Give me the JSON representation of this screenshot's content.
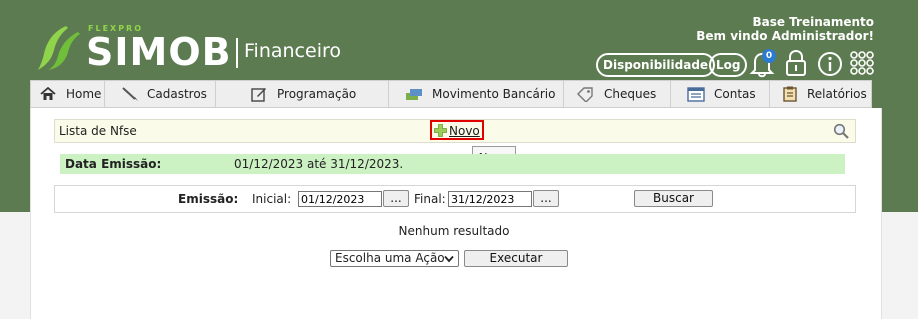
{
  "brand": {
    "small": "FLEXPRO",
    "name": "SIMOB",
    "module": "Financeiro",
    "logo_color": "#8fd44a"
  },
  "header": {
    "company": "Base Treinamento",
    "welcome": "Bem vindo Administrador!",
    "availability_label": "Disponibilidade",
    "log_label": "Log",
    "notification_count": "0",
    "bg_color": "#5d7b51"
  },
  "nav": {
    "items": [
      {
        "label": "Home",
        "icon": "home-icon"
      },
      {
        "label": "Cadastros",
        "icon": "pen-icon"
      },
      {
        "label": "Programação",
        "icon": "edit-icon"
      },
      {
        "label": "Movimento Bancário",
        "icon": "money-icon"
      },
      {
        "label": "Cheques",
        "icon": "tag-icon"
      },
      {
        "label": "Contas",
        "icon": "ledger-icon"
      },
      {
        "label": "Relatórios",
        "icon": "report-icon"
      }
    ]
  },
  "list": {
    "title": "Lista de Nfse",
    "new_label": "Novo",
    "tooltip": "Novo"
  },
  "filter": {
    "label": "Data Emissão:",
    "value": "01/12/2023 até 31/12/2023."
  },
  "search": {
    "emissao_label": "Emissão:",
    "inicial_label": "Inicial:",
    "inicial_value": "01/12/2023",
    "picker_label": "...",
    "final_label": "Final:",
    "final_value": "31/12/2023",
    "buscar_label": "Buscar"
  },
  "results": {
    "empty_text": "Nenhum resultado",
    "action_select": "Escolha uma Ação",
    "execute_label": "Executar"
  }
}
